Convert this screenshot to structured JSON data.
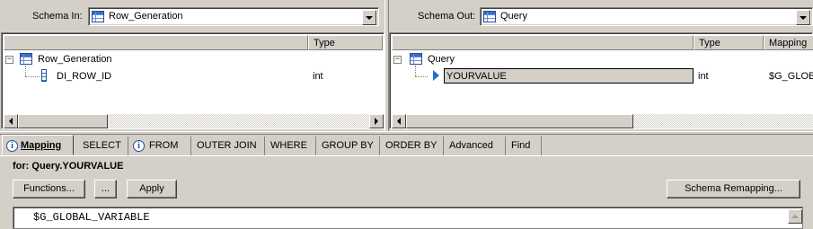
{
  "left_pane": {
    "schema_label": "Schema In:",
    "schema_value": "Row_Generation",
    "columns": [
      "",
      "Type"
    ],
    "root": "Row_Generation",
    "rows": [
      {
        "name": "DI_ROW_ID",
        "type": "int"
      }
    ]
  },
  "right_pane": {
    "schema_label": "Schema Out:",
    "schema_value": "Query",
    "columns": [
      "",
      "Type",
      "Mapping"
    ],
    "root": "Query",
    "rows": [
      {
        "name": "YOURVALUE",
        "type": "int",
        "mapping": "$G_GLOBA"
      }
    ]
  },
  "tabs": [
    "Mapping",
    "SELECT",
    "FROM",
    "OUTER JOIN",
    "WHERE",
    "GROUP BY",
    "ORDER BY",
    "Advanced",
    "Find"
  ],
  "mapping": {
    "for_label": "for: Query.YOURVALUE",
    "functions_button": "Functions...",
    "ellipsis_button": "...",
    "apply_button": "Apply",
    "remap_button": "Schema Remapping...",
    "expression": "$G_GLOBAL_VARIABLE"
  },
  "colors": {
    "selection_border": "#000000",
    "row_highlight": "#d4d0c8",
    "accent_blue": "#1f4f9f"
  }
}
